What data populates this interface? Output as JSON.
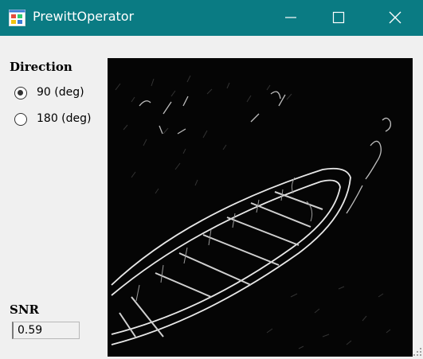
{
  "window": {
    "title": "PrewittOperator",
    "icon": "app-window-icon",
    "controls": [
      "minimize-icon",
      "maximize-icon",
      "close-icon"
    ]
  },
  "direction": {
    "label": "Direction",
    "options": [
      {
        "label": "90 (deg)",
        "selected": true
      },
      {
        "label": "180 (deg)",
        "selected": false
      }
    ]
  },
  "snr": {
    "label": "SNR",
    "value": "0.59"
  },
  "image": {
    "description_icon": "edge-detected-boat-image"
  },
  "colors": {
    "titlebar": "#0a7b83",
    "background": "#f0f0f0",
    "image_background": "#050505"
  }
}
